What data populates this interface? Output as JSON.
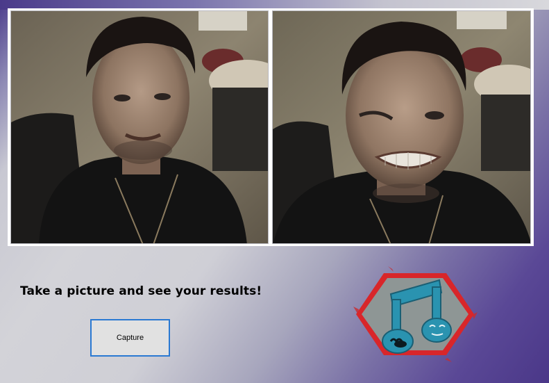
{
  "webcam": {
    "left_label": "",
    "right_label": ""
  },
  "prompt_text": "Take a picture and see your results!",
  "capture_button_label": "Capture",
  "logo_icon": "music-note-face-icon",
  "colors": {
    "background_start": "#4b3c8c",
    "background_mid": "#d3d3d8",
    "button_border": "#2a79d2",
    "logo_hex_border": "#d8262a",
    "logo_note": "#2a93b0"
  }
}
